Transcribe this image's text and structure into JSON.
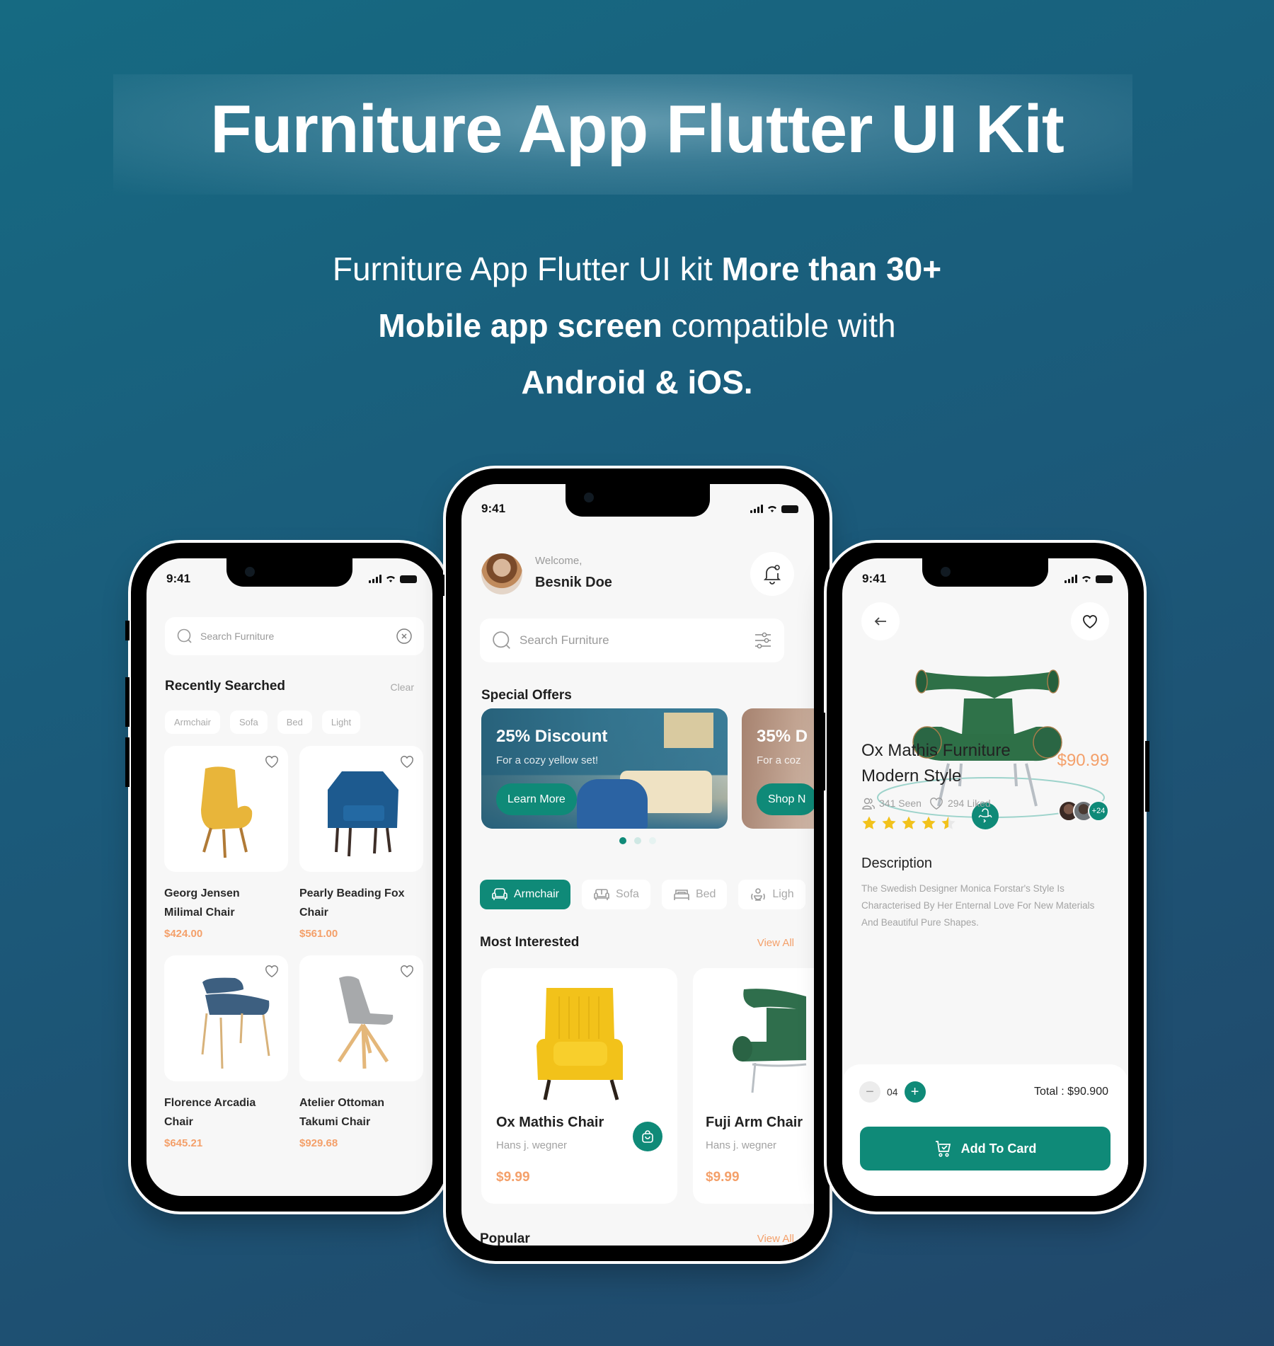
{
  "hero": {
    "title": "Furniture App Flutter UI Kit",
    "subtitle_line1_regular": "Furniture App Flutter UI kit ",
    "subtitle_line1_bold": "More than 30+",
    "subtitle_line2_bold": "Mobile app screen",
    "subtitle_line2_regular": " compatible with",
    "subtitle_line3_bold": "Android & iOS."
  },
  "colors": {
    "accent": "#0f8a78",
    "price": "#f4a06a",
    "background_top": "#166a82",
    "background_bottom": "#21476a",
    "screen_bg": "#f7f7f7"
  },
  "status_bar": {
    "time": "9:41",
    "icons": [
      "signal-icon",
      "wifi-icon",
      "battery-icon"
    ]
  },
  "search_screen": {
    "search": {
      "placeholder": "Search Furniture",
      "leading_icon": "search-icon",
      "trailing_icon": "clear-circle-icon"
    },
    "recent": {
      "title": "Recently Searched",
      "clear_label": "Clear",
      "chips": [
        "Armchair",
        "Sofa",
        "Bed",
        "Light"
      ]
    },
    "products": [
      {
        "name_line1": "Georg Jensen",
        "name_line2": "Milimal Chair",
        "price": "$424.00",
        "color": "#e8b53a"
      },
      {
        "name_line1": "Pearly Beading Fox",
        "name_line2": "Chair",
        "price": "$561.00",
        "color": "#1d5a8f"
      },
      {
        "name_line1": "Florence Arcadia",
        "name_line2": "Chair",
        "price": "$645.21",
        "color": "#3d5f80"
      },
      {
        "name_line1": "Atelier Ottoman",
        "name_line2": "Takumi Chair",
        "price": "$929.68",
        "color": "#a7a9ab"
      }
    ]
  },
  "home_screen": {
    "greeting": "Welcome,",
    "user_name": "Besnik Doe",
    "search": {
      "placeholder": "Search Furniture",
      "leading_icon": "search-icon",
      "trailing_icon": "filter-sliders-icon"
    },
    "special_offers": {
      "title": "Special Offers",
      "offers": [
        {
          "headline": "25% Discount",
          "subtext": "For a cozy yellow set!",
          "button": "Learn More"
        },
        {
          "headline": "35% D",
          "subtext": "For a coz",
          "button": "Shop N"
        }
      ],
      "carousel_dots": 3,
      "active_dot": 1
    },
    "categories": [
      {
        "label": "Armchair",
        "icon": "armchair-icon",
        "active": true
      },
      {
        "label": "Sofa",
        "icon": "sofa-icon",
        "active": false
      },
      {
        "label": "Bed",
        "icon": "bed-icon",
        "active": false
      },
      {
        "label": "Ligh",
        "icon": "lamp-icon",
        "active": false
      }
    ],
    "most_interested": {
      "title": "Most Interested",
      "view_all": "View All",
      "items": [
        {
          "name": "Ox Mathis Chair",
          "designer": "Hans j. wegner",
          "price": "$9.99",
          "color": "#f2c21a"
        },
        {
          "name": "Fuji Arm Chair",
          "designer": "Hans j. wegner",
          "price": "$9.99",
          "color": "#2f6e4c"
        }
      ]
    },
    "popular": {
      "title": "Popular",
      "view_all": "View All"
    }
  },
  "detail_screen": {
    "product_name_line1": "Ox Mathis Furniture",
    "product_name_line2": "Modern Style",
    "price": "$90.99",
    "seen": "341 Seen",
    "liked": "294 Liked",
    "rating": 4.5,
    "rating_max": 5,
    "extra_avatars": "+24",
    "description_title": "Description",
    "description": "The Swedish Designer Monica Forstar's Style Is Characterised By Her Enternal Love For New Materials And Beautiful Pure Shapes.",
    "quantity": "04",
    "total": "Total : $90.900",
    "add_button": "Add To Card"
  }
}
